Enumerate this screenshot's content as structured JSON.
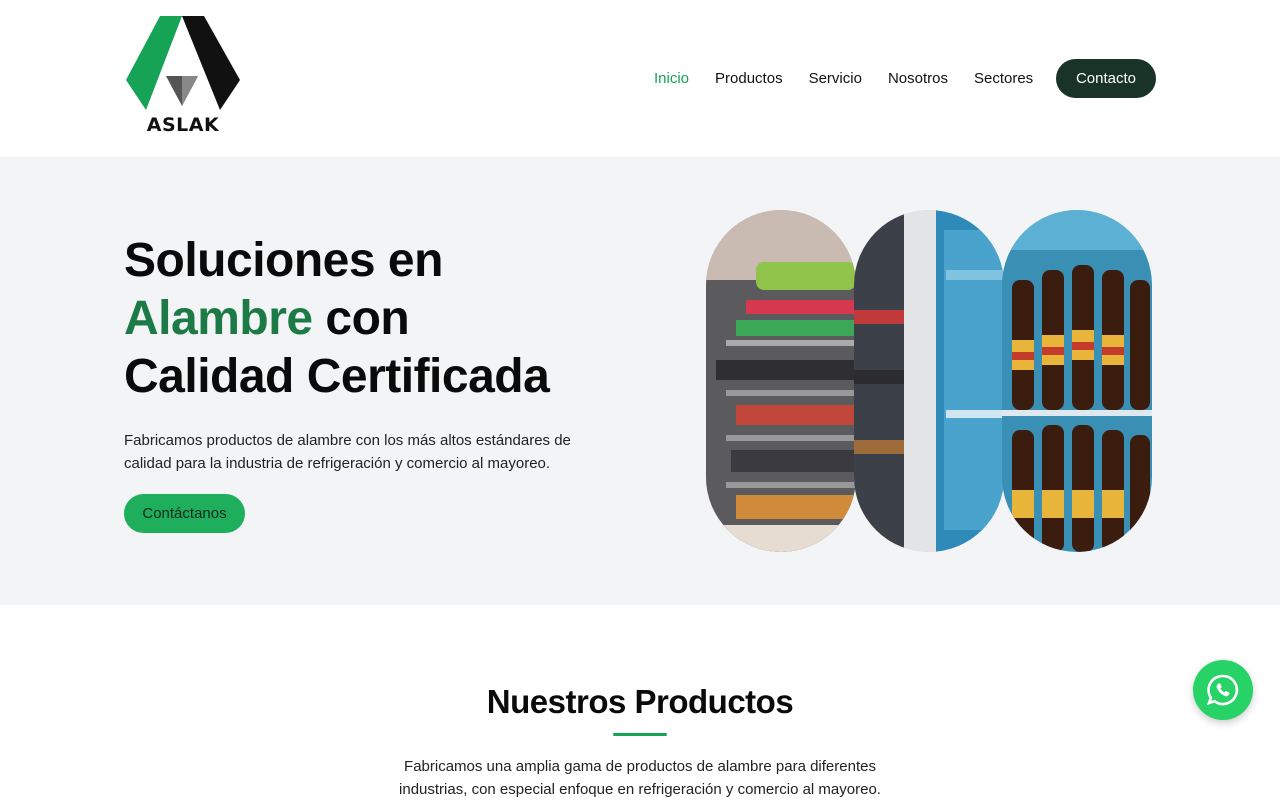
{
  "brand": {
    "logo_text": "ASLAK",
    "colors": {
      "green": "#17a355",
      "dark_green": "#1a3327",
      "hero_bg": "#f3f4f6",
      "whatsapp": "#27d366"
    }
  },
  "nav": {
    "items": [
      {
        "label": "Inicio",
        "active": true
      },
      {
        "label": "Productos",
        "active": false
      },
      {
        "label": "Servicio",
        "active": false
      },
      {
        "label": "Nosotros",
        "active": false
      },
      {
        "label": "Sectores",
        "active": false
      }
    ],
    "contact_label": "Contacto"
  },
  "hero": {
    "title_line1": "Soluciones en",
    "title_highlight": "Alambre",
    "title_line2_rest": " con",
    "title_line3": "Calidad Certificada",
    "subtitle": "Fabricamos productos de alambre con los más altos estándares de calidad para la industria de refrigeración y comercio al mayoreo.",
    "cta_label": "Contáctanos"
  },
  "products": {
    "title": "Nuestros Productos",
    "description": "Fabricamos una amplia gama de productos de alambre para diferentes industrias, con especial enfoque en refrigeración y comercio al mayoreo."
  },
  "floating": {
    "icon": "whatsapp-icon"
  }
}
